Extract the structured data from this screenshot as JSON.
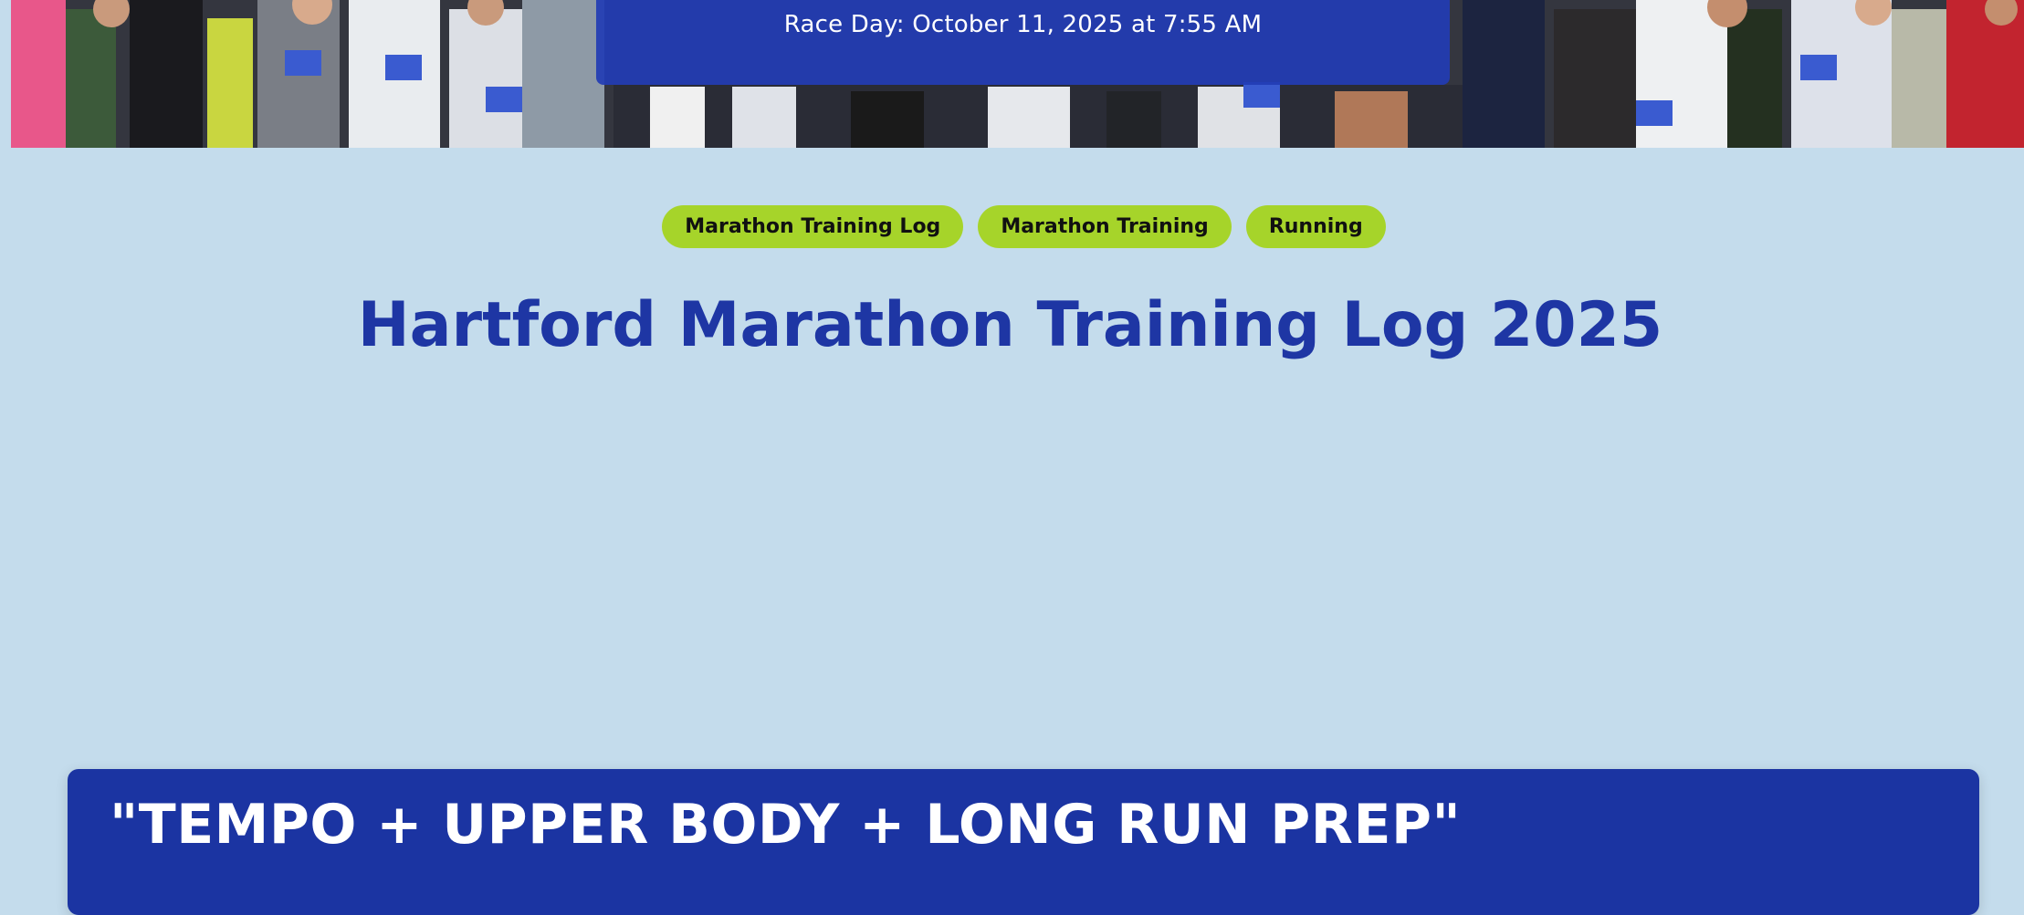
{
  "hero": {
    "race_day": "Race Day: October 11, 2025 at 7:55 AM",
    "photo_icon": "runners-crowd-photo"
  },
  "tags": [
    {
      "label": "Marathon Training Log"
    },
    {
      "label": "Marathon Training"
    },
    {
      "label": "Running"
    }
  ],
  "page": {
    "title": "Hartford Marathon Training Log 2025"
  },
  "post": {
    "title": "\"TEMPO + UPPER BODY + LONG RUN PREP\""
  },
  "colors": {
    "background": "#c4dcec",
    "banner": "#223cb4",
    "tag": "#a6d42a",
    "title": "#1e36a4",
    "card": "#1b34a2"
  }
}
